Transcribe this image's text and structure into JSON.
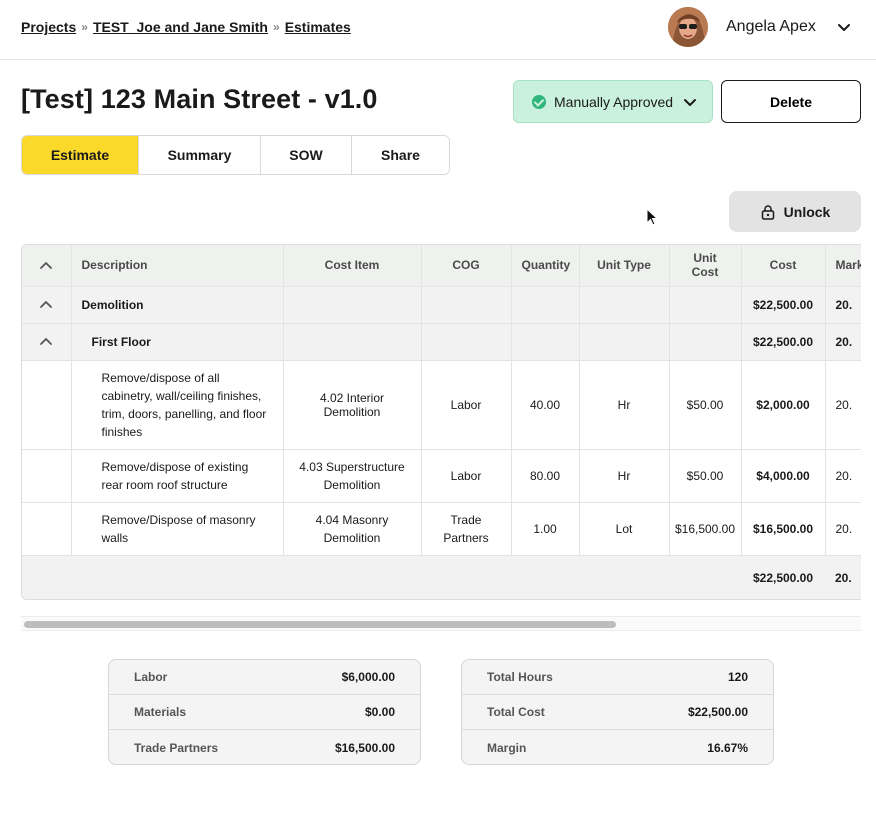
{
  "breadcrumb": {
    "items": [
      "Projects",
      "TEST_Joe and Jane Smith",
      "Estimates"
    ],
    "separator": "»"
  },
  "user": {
    "name": "Angela Apex"
  },
  "page": {
    "title": "[Test] 123 Main Street - v1.0"
  },
  "status": {
    "label": "Manually Approved",
    "color": "#2fb67c"
  },
  "actions": {
    "delete_label": "Delete",
    "unlock_label": "Unlock"
  },
  "tabs": [
    {
      "label": "Estimate",
      "active": true
    },
    {
      "label": "Summary",
      "active": false
    },
    {
      "label": "SOW",
      "active": false
    },
    {
      "label": "Share",
      "active": false
    }
  ],
  "table": {
    "columns": [
      "Description",
      "Cost Item",
      "COG",
      "Quantity",
      "Unit Type",
      "Unit Cost",
      "Cost",
      "Mark"
    ],
    "groups": [
      {
        "description": "Demolition",
        "cost": "$22,500.00",
        "markup": "20."
      },
      {
        "description": "First Floor",
        "cost": "$22,500.00",
        "markup": "20."
      }
    ],
    "rows": [
      {
        "description": "Remove/dispose of all cabinetry, wall/ceiling finishes, trim, doors, panelling, and floor finishes",
        "cost_item": "4.02 Interior Demolition",
        "cog": "Labor",
        "quantity": "40.00",
        "unit_type": "Hr",
        "unit_cost": "$50.00",
        "cost": "$2,000.00",
        "markup": "20."
      },
      {
        "description": "Remove/dispose of existing rear room roof structure",
        "cost_item": "4.03 Superstructure Demolition",
        "cog": "Labor",
        "quantity": "80.00",
        "unit_type": "Hr",
        "unit_cost": "$50.00",
        "cost": "$4,000.00",
        "markup": "20."
      },
      {
        "description": "Remove/Dispose of masonry walls",
        "cost_item": "4.04 Masonry Demolition",
        "cog": "Trade Partners",
        "quantity": "1.00",
        "unit_type": "Lot",
        "unit_cost": "$16,500.00",
        "cost": "$16,500.00",
        "markup": "20."
      }
    ],
    "total": {
      "cost": "$22,500.00",
      "markup": "20."
    }
  },
  "scrollbar": {
    "horizontal_position": 0.0
  },
  "summary_left": [
    {
      "label": "Labor",
      "value": "$6,000.00"
    },
    {
      "label": "Materials",
      "value": "$0.00"
    },
    {
      "label": "Trade Partners",
      "value": "$16,500.00"
    }
  ],
  "summary_right": [
    {
      "label": "Total Hours",
      "value": "120"
    },
    {
      "label": "Total Cost",
      "value": "$22,500.00"
    },
    {
      "label": "Margin",
      "value": "16.67%"
    }
  ],
  "colors": {
    "accent_tab": "#fbd92b",
    "status_bg": "#c9f1dd",
    "header_bg": "#eef1ee",
    "group_bg": "#f2f2f2"
  },
  "icons": [
    "chevron-right-double-icon",
    "chevron-down-icon",
    "check-circle-icon",
    "lock-icon",
    "chevron-up-icon",
    "mouse-cursor-icon"
  ]
}
